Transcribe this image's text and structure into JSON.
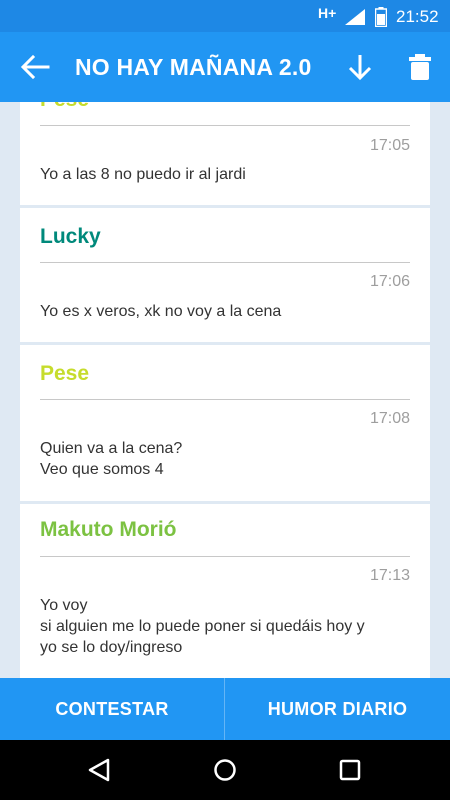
{
  "status_bar": {
    "network": "H+",
    "time": "21:52"
  },
  "app_bar": {
    "title": "NO HAY MAÑANA 2.0"
  },
  "messages": [
    {
      "author": "Pese",
      "author_color": "#c6dc2c",
      "time": "17:05",
      "lines": [
        "Yo a las 8 no puedo ir al jardi"
      ]
    },
    {
      "author": "Lucky",
      "author_color": "#00897b",
      "time": "17:06",
      "lines": [
        "Yo es x veros, xk no voy a la cena"
      ]
    },
    {
      "author": "Pese",
      "author_color": "#c6dc2c",
      "time": "17:08",
      "lines": [
        "Quien va a la cena?",
        "Veo que somos 4"
      ]
    },
    {
      "author": "Makuto Morió",
      "author_color": "#7cc242",
      "time": "17:13",
      "lines": [
        "Yo voy",
        "si alguien me lo puede poner si quedáis hoy y",
        "yo se lo doy/ingreso"
      ]
    }
  ],
  "bottom_buttons": {
    "reply": "CONTESTAR",
    "daily_humor": "HUMOR DIARIO"
  },
  "colors": {
    "primary": "#2196f3",
    "status_bar": "#1e88e5",
    "background": "#dfe9f3"
  }
}
